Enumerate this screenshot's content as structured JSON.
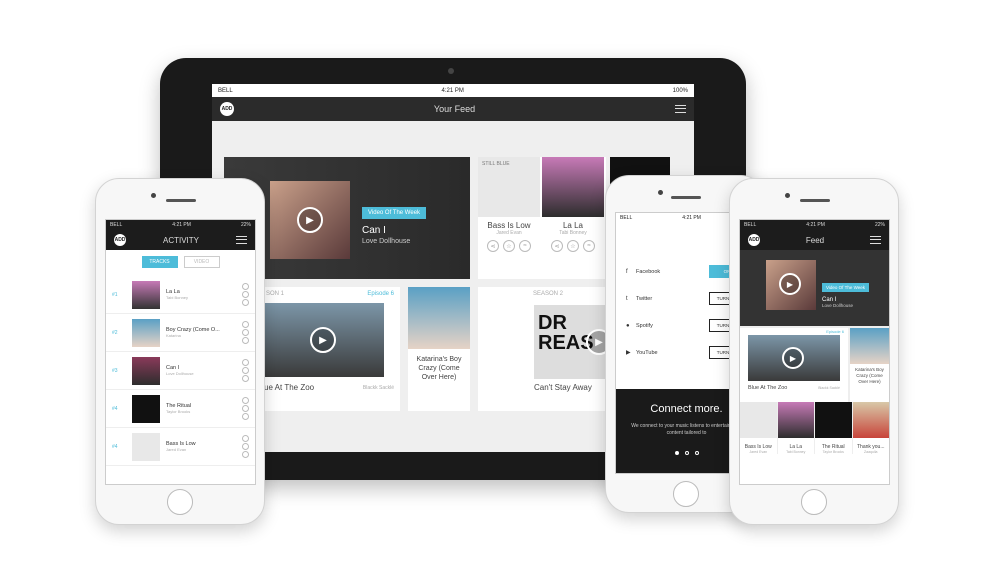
{
  "ipad": {
    "status": {
      "carrier": "BELL",
      "time": "4:21 PM",
      "battery": "100%"
    },
    "title": "Your Feed",
    "logo": "ADD",
    "video_of_week": {
      "badge": "Video Of The Week",
      "title": "Can I",
      "artist": "Love Dollhouse"
    },
    "tracks": [
      {
        "title": "Bass Is Low",
        "artist": "Jared Evan",
        "art_text": "STILL BLUE"
      },
      {
        "title": "La La",
        "artist": "Tabi Bonney"
      }
    ],
    "season1": {
      "label": "SON 1",
      "episode": "Episode 6",
      "title": "ue At The Zoo",
      "artist": "Blackk Sacklé"
    },
    "katarina": {
      "title": "Katarina's Boy Crazy (Come Over Here)"
    },
    "season2": {
      "label": "SEASON 2",
      "title": "Can't Stay Away",
      "art_text": "DR REAS"
    }
  },
  "activity": {
    "status": {
      "carrier": "BELL",
      "time": "4:21 PM",
      "battery": "22%"
    },
    "title": "ACTIVITY",
    "logo": "ADD",
    "tabs": [
      "TRACKS",
      "VIDEO"
    ],
    "rows": [
      {
        "num": "#1",
        "title": "La La",
        "artist": "Tabi Bonney"
      },
      {
        "num": "#2",
        "title": "Boy Crazy (Come O...",
        "artist": "Katarina"
      },
      {
        "num": "#3",
        "title": "Can I",
        "artist": "Love Dollhouse"
      },
      {
        "num": "#4",
        "title": "The Ritual",
        "artist": "Taylor Brooks"
      },
      {
        "num": "#4",
        "title": "Bass Is Low",
        "artist": "Jared Evan"
      }
    ]
  },
  "connect": {
    "status": {
      "carrier": "BELL",
      "time": "4:21 PM"
    },
    "services": [
      {
        "icon": "facebook-icon",
        "glyph": "f",
        "name": "Facebook",
        "button": "ON",
        "on": true
      },
      {
        "icon": "twitter-icon",
        "glyph": "t",
        "name": "Twitter",
        "button": "TURN ON",
        "on": false
      },
      {
        "icon": "spotify-icon",
        "glyph": "●",
        "name": "Spotify",
        "button": "TURN ON",
        "on": false
      },
      {
        "icon": "youtube-icon",
        "glyph": "▶",
        "name": "YouTube",
        "button": "TURN ON",
        "on": false
      }
    ],
    "heading": "Connect more.",
    "body": "We connect to your music listens to entertainment content tailored to"
  },
  "feed": {
    "status": {
      "carrier": "BELL",
      "time": "4:21 PM",
      "battery": "22%"
    },
    "title": "Feed",
    "logo": "ADD",
    "video_of_week": {
      "badge": "Video Of The Week",
      "title": "Can I",
      "artist": "Love Dollhouse"
    },
    "episode": "Episode 6",
    "video_title": "Blue At The Zoo",
    "video_artist": "Blackk Sacklé",
    "katarina": "Katarina's Boy Crazy (Come Over Here)",
    "tracks": [
      {
        "title": "Bass Is Low",
        "artist": "Jared Evan"
      },
      {
        "title": "La La",
        "artist": "Tabi Bonney"
      },
      {
        "title": "The Ritual",
        "artist": "Taylor Brooks"
      },
      {
        "title": "Thank you...",
        "artist": "Zaaqulla"
      }
    ]
  }
}
